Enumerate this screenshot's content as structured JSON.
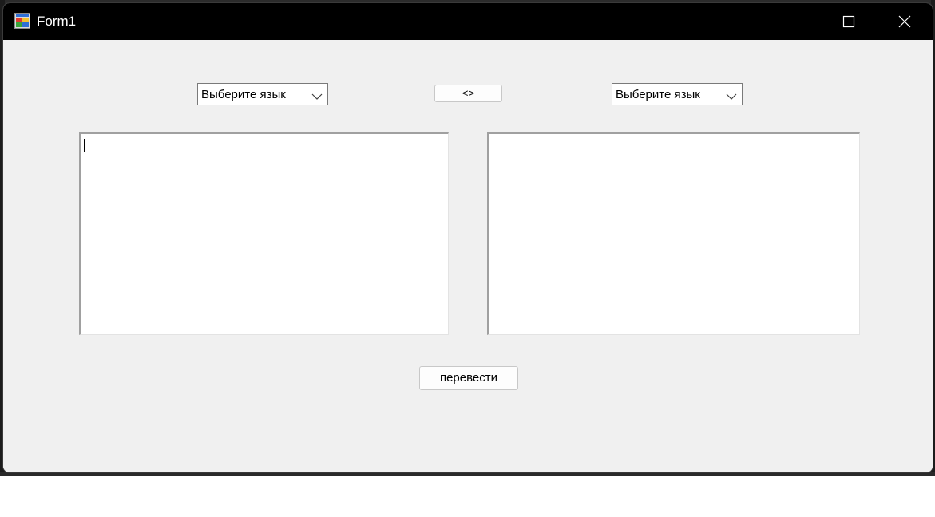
{
  "window": {
    "title": "Form1",
    "icon": "winforms-app-icon",
    "controls": {
      "minimize_icon": "minimize-icon",
      "maximize_icon": "maximize-icon",
      "close_icon": "close-icon"
    }
  },
  "form": {
    "source_language": {
      "selected": "Выберите язык"
    },
    "target_language": {
      "selected": "Выберите язык"
    },
    "swap_button_label": "<>",
    "source_text": "",
    "target_text": "",
    "translate_button_label": "перевести"
  },
  "colors": {
    "titlebar": "#000000",
    "form_background": "#f0f0f0",
    "textbox_background": "#ffffff"
  }
}
